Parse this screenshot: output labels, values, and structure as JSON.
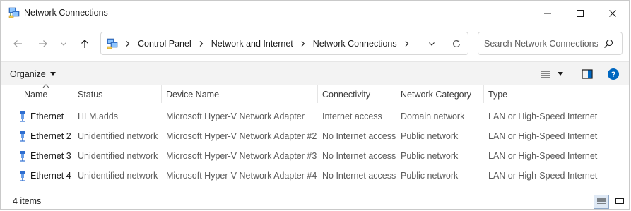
{
  "window": {
    "title": "Network Connections",
    "icon": "network-connections-icon"
  },
  "titlebar_buttons": [
    "minimize",
    "maximize",
    "close"
  ],
  "navigation": {
    "back": "arrow-left-icon",
    "forward": "arrow-right-icon",
    "recent": "chevron-down-icon",
    "up": "arrow-up-icon"
  },
  "address": {
    "breadcrumbs": [
      "Control Panel",
      "Network and Internet",
      "Network Connections"
    ]
  },
  "search": {
    "placeholder": "Search Network Connections",
    "value": ""
  },
  "toolbar": {
    "organize_label": "Organize"
  },
  "columns": [
    "Name",
    "Status",
    "Device Name",
    "Connectivity",
    "Network Category",
    "Type"
  ],
  "sort": {
    "column": "Name",
    "direction": "ascending"
  },
  "rows": [
    {
      "name": "Ethernet",
      "status": "HLM.adds",
      "device": "Microsoft Hyper-V Network Adapter",
      "connectivity": "Internet access",
      "category": "Domain network",
      "type": "LAN or High-Speed Internet"
    },
    {
      "name": "Ethernet 2",
      "status": "Unidentified network",
      "device": "Microsoft Hyper-V Network Adapter #2",
      "connectivity": "No Internet access",
      "category": "Public network",
      "type": "LAN or High-Speed Internet"
    },
    {
      "name": "Ethernet 3",
      "status": "Unidentified network",
      "device": "Microsoft Hyper-V Network Adapter #3",
      "connectivity": "No Internet access",
      "category": "Public network",
      "type": "LAN or High-Speed Internet"
    },
    {
      "name": "Ethernet 4",
      "status": "Unidentified network",
      "device": "Microsoft Hyper-V Network Adapter #4",
      "connectivity": "No Internet access",
      "category": "Public network",
      "type": "LAN or High-Speed Internet"
    }
  ],
  "statusbar": {
    "item_count": "4 items",
    "active_view": "details"
  },
  "colors": {
    "accent": "#0067c0",
    "toolbar_bg": "#f3f3f3",
    "border": "#d8d8d8",
    "secondary_text": "#5a5a5a"
  }
}
